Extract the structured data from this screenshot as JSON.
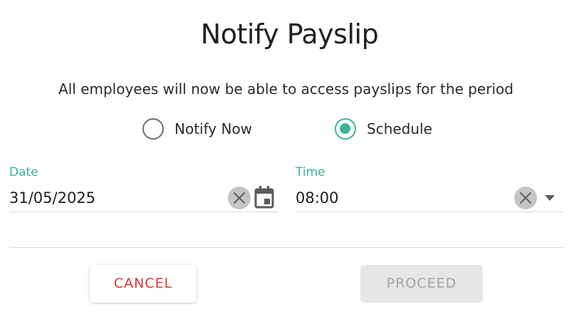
{
  "dialog": {
    "title": "Notify Payslip",
    "subtitle": "All employees will now be able to access payslips for the period"
  },
  "radio_options": [
    {
      "label": "Notify Now",
      "checked": false
    },
    {
      "label": "Schedule",
      "checked": true
    }
  ],
  "date_field": {
    "label": "Date",
    "value": "31/05/2025",
    "icons": [
      "clear-icon",
      "calendar-icon"
    ]
  },
  "time_field": {
    "label": "Time",
    "value": "08:00",
    "icons": [
      "clear-icon",
      "chevron-down-icon"
    ]
  },
  "actions": {
    "cancel_label": "CANCEL",
    "proceed_label": "PROCEED",
    "proceed_disabled": true
  },
  "colors": {
    "accent": "#3bb39a",
    "danger": "#e0362e",
    "disabled_bg": "#e6e6e6",
    "disabled_text": "#a3a3a3"
  }
}
